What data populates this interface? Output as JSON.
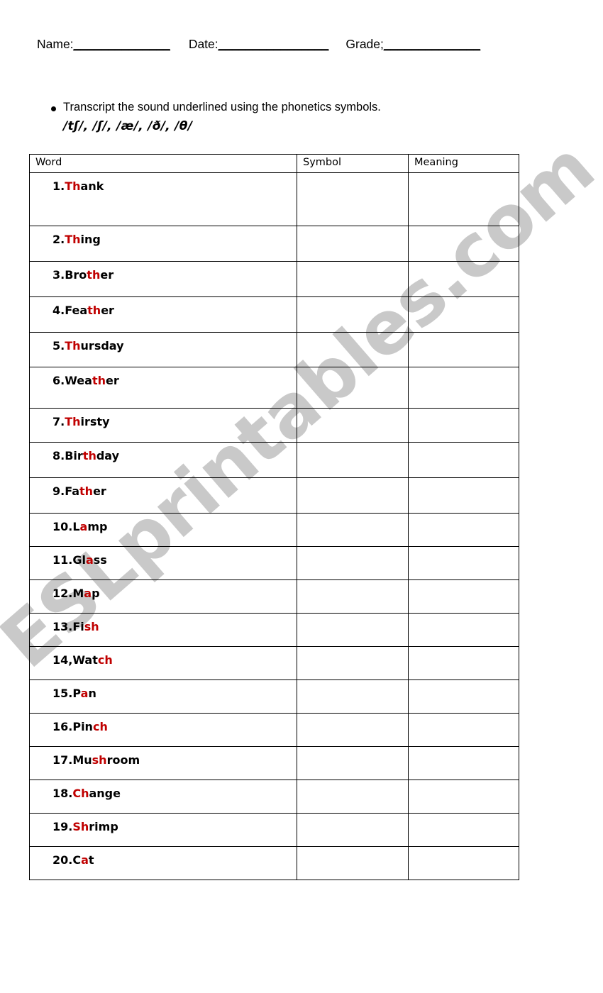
{
  "header": {
    "name_label": "Name:",
    "name_rule": "______________",
    "date_label": "Date:",
    "date_rule": "________________",
    "grade_label": "Grade;",
    "grade_rule": "______________"
  },
  "instructions": {
    "bullet_icon": "bullet-dot-icon",
    "text": "Transcript the sound underlined using the phonetics symbols.",
    "phonetic_symbols": "/tʃ/, /ʃ/, /æ/, /ð/, /θ/"
  },
  "table": {
    "columns": [
      "Word",
      "Symbol",
      "Meaning"
    ],
    "highlight_color": "#c00000",
    "rows": [
      {
        "num": "1.",
        "pre": "",
        "hl": "Th",
        "post": "ank"
      },
      {
        "num": "2.",
        "pre": "",
        "hl": "Th",
        "post": "ing"
      },
      {
        "num": "3.",
        "pre": "Bro",
        "hl": "th",
        "post": "er"
      },
      {
        "num": "4.",
        "pre": "Fea",
        "hl": "th",
        "post": "er"
      },
      {
        "num": "5.",
        "pre": "",
        "hl": "Th",
        "post": "ursday"
      },
      {
        "num": "6.",
        "pre": "Wea",
        "hl": "th",
        "post": "er"
      },
      {
        "num": "7.",
        "pre": "",
        "hl": "Th",
        "post": "irsty"
      },
      {
        "num": "8.",
        "pre": "Bir",
        "hl": "th",
        "post": "day"
      },
      {
        "num": "9.",
        "pre": "Fa",
        "hl": "th",
        "post": "er"
      },
      {
        "num": "10.",
        "pre": "L",
        "hl": "a",
        "post": "mp"
      },
      {
        "num": "11.",
        "pre": "Gl",
        "hl": "a",
        "post": "ss"
      },
      {
        "num": "12.",
        "pre": "M",
        "hl": "a",
        "post": "p"
      },
      {
        "num": "13.",
        "pre": "Fi",
        "hl": "sh",
        "post": ""
      },
      {
        "num": "14,",
        "pre": "Wat",
        "hl": "ch",
        "post": ""
      },
      {
        "num": "15.",
        "pre": "P",
        "hl": "a",
        "post": "n"
      },
      {
        "num": "16.",
        "pre": "Pin",
        "hl": "ch",
        "post": ""
      },
      {
        "num": "17.",
        "pre": "Mu",
        "hl": "sh",
        "post": "room"
      },
      {
        "num": "18.",
        "pre": "",
        "hl": "Ch",
        "post": "ange"
      },
      {
        "num": "19.",
        "pre": "",
        "hl": "Sh",
        "post": "rimp"
      },
      {
        "num": "20.",
        "pre": "C",
        "hl": "a",
        "post": "t"
      }
    ]
  },
  "watermark": {
    "text": "ESLprintables.com",
    "color": "#c9c9c9"
  }
}
